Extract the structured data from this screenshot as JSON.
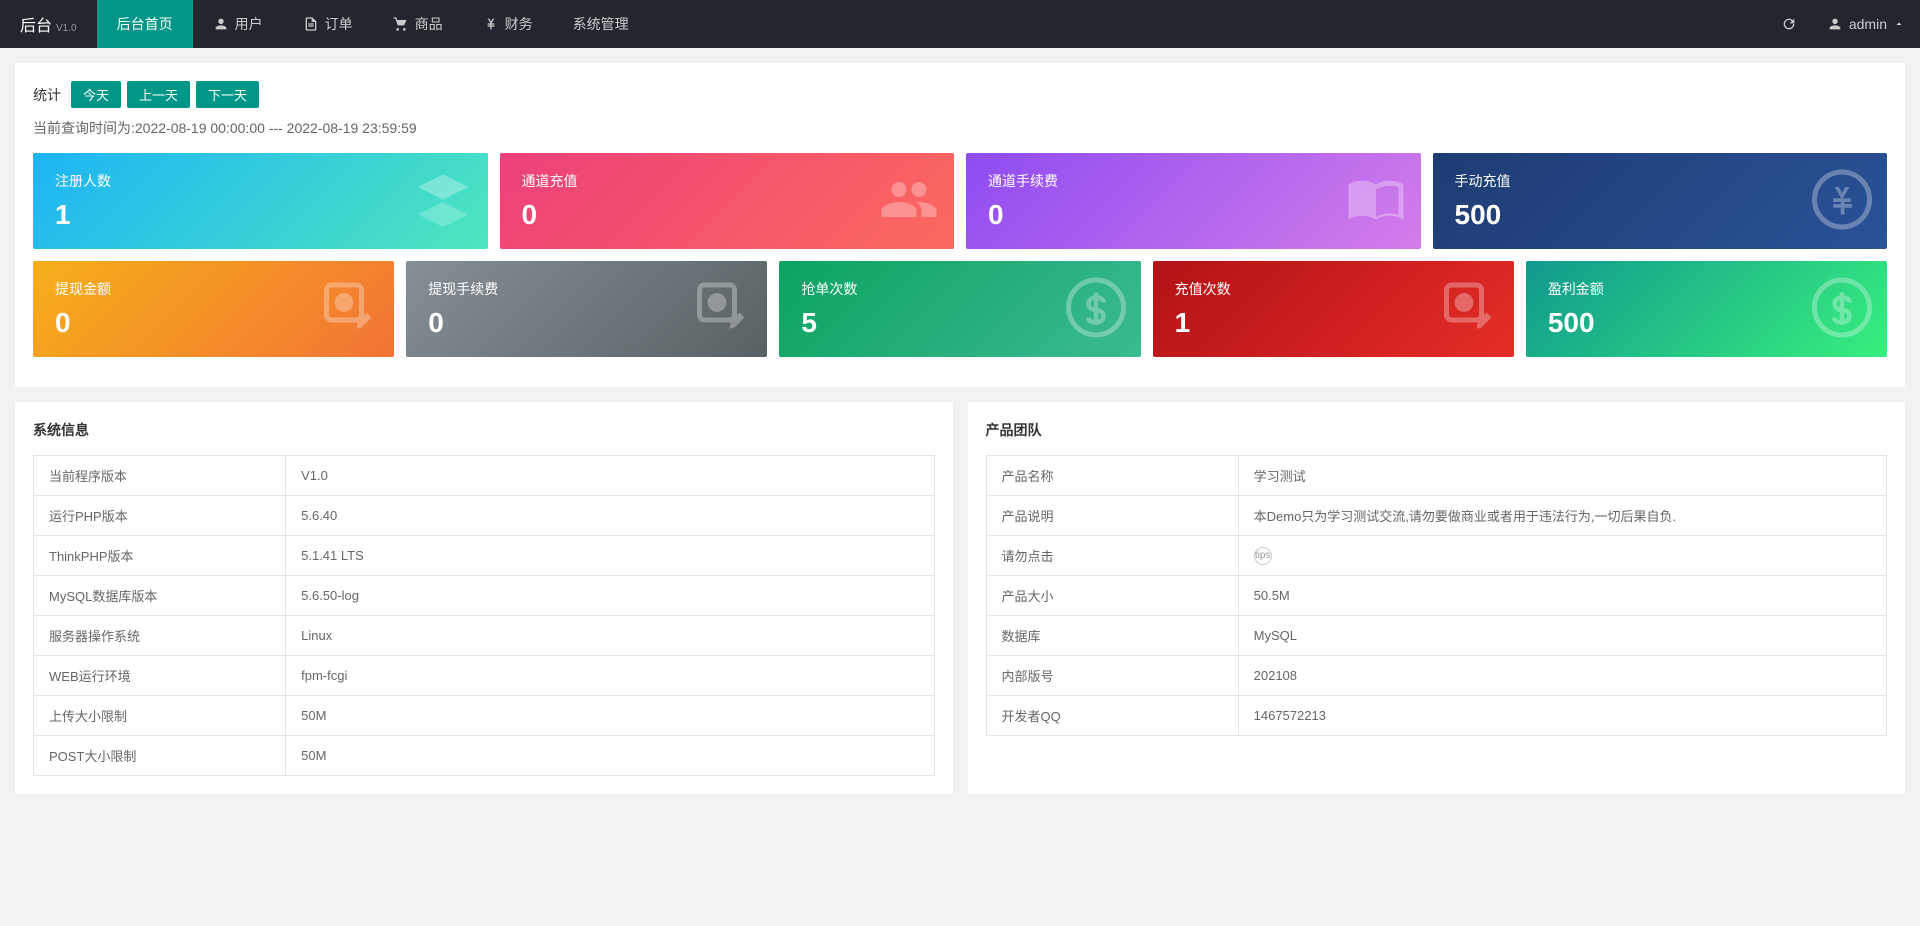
{
  "header": {
    "logo": "后台",
    "version": "V1.0",
    "nav": [
      {
        "label": "后台首页",
        "active": true,
        "icon": null
      },
      {
        "label": "用户",
        "icon": "user"
      },
      {
        "label": "订单",
        "icon": "doc"
      },
      {
        "label": "商品",
        "icon": "cart"
      },
      {
        "label": "财务",
        "icon": "yen"
      },
      {
        "label": "系统管理",
        "icon": null
      }
    ],
    "user": "admin"
  },
  "filter": {
    "label": "统计",
    "buttons": [
      "今天",
      "上一天",
      "下一天"
    ],
    "query_time": "当前查询时间为:2022-08-19 00:00:00 --- 2022-08-19 23:59:59"
  },
  "stats_row1": [
    {
      "title": "注册人数",
      "value": "1",
      "class": "grad-blue",
      "icon": "layers"
    },
    {
      "title": "通道充值",
      "value": "0",
      "class": "grad-pink",
      "icon": "users"
    },
    {
      "title": "通道手续费",
      "value": "0",
      "class": "grad-purple",
      "icon": "book"
    },
    {
      "title": "手动充值",
      "value": "500",
      "class": "grad-navy",
      "icon": "yen-circle"
    }
  ],
  "stats_row2": [
    {
      "title": "提现金额",
      "value": "0",
      "class": "grad-orange",
      "icon": "edit"
    },
    {
      "title": "提现手续费",
      "value": "0",
      "class": "grad-gray",
      "icon": "edit"
    },
    {
      "title": "抢单次数",
      "value": "5",
      "class": "grad-teal",
      "icon": "dollar"
    },
    {
      "title": "充值次数",
      "value": "1",
      "class": "grad-red",
      "icon": "edit"
    },
    {
      "title": "盈利金额",
      "value": "500",
      "class": "grad-green",
      "icon": "dollar"
    }
  ],
  "system_info": {
    "title": "系统信息",
    "rows": [
      {
        "k": "当前程序版本",
        "v": "V1.0"
      },
      {
        "k": "运行PHP版本",
        "v": "5.6.40"
      },
      {
        "k": "ThinkPHP版本",
        "v": "5.1.41 LTS"
      },
      {
        "k": "MySQL数据库版本",
        "v": "5.6.50-log"
      },
      {
        "k": "服务器操作系统",
        "v": "Linux"
      },
      {
        "k": "WEB运行环境",
        "v": "fpm-fcgi"
      },
      {
        "k": "上传大小限制",
        "v": "50M"
      },
      {
        "k": "POST大小限制",
        "v": "50M"
      }
    ]
  },
  "product_team": {
    "title": "产品团队",
    "rows": [
      {
        "k": "产品名称",
        "v": "学习测试"
      },
      {
        "k": "产品说明",
        "v": "本Demo只为学习测试交流,请勿要做商业或者用于违法行为,一切后果自负."
      },
      {
        "k": "请勿点击",
        "v": "__tips__"
      },
      {
        "k": "产品大小",
        "v": "50.5M"
      },
      {
        "k": "数据库",
        "v": "MySQL"
      },
      {
        "k": "内部版号",
        "v": "202108"
      },
      {
        "k": "开发者QQ",
        "v": "1467572213"
      }
    ]
  }
}
